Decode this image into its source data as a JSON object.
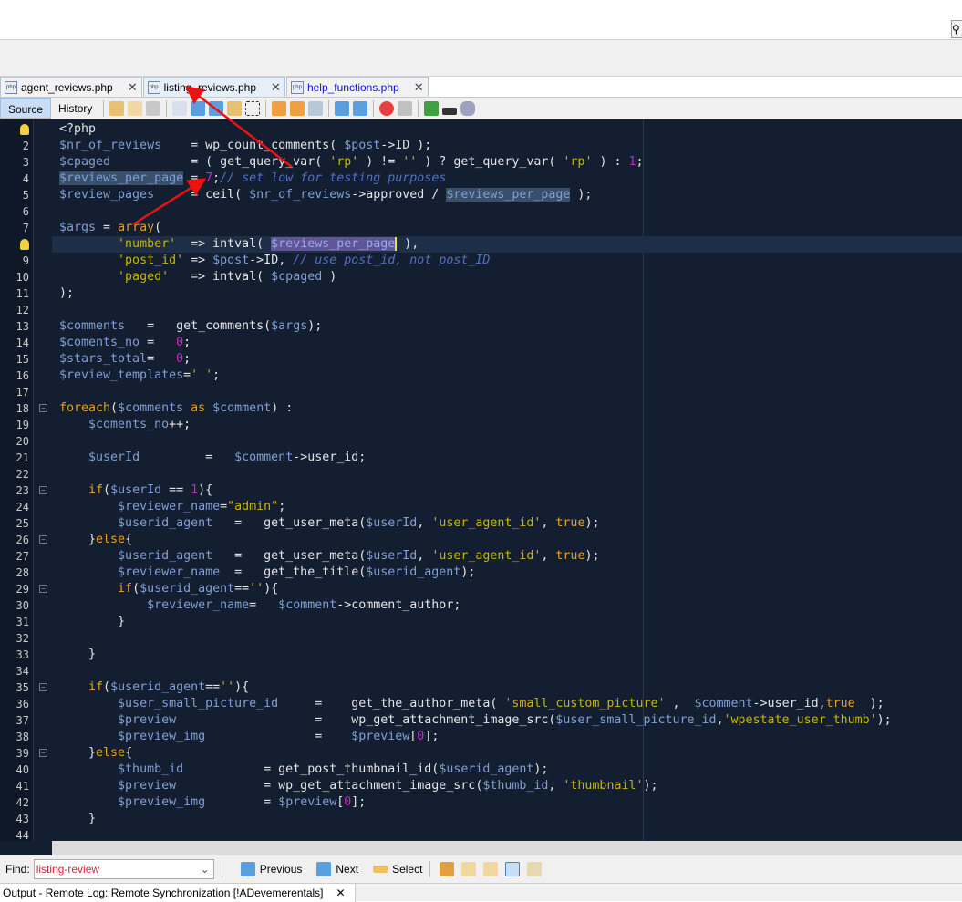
{
  "tabs": [
    {
      "label": "agent_reviews.php"
    },
    {
      "label": "listing_reviews.php",
      "active": true
    },
    {
      "label": "help_functions.php"
    }
  ],
  "toolbar": {
    "source": "Source",
    "history": "History"
  },
  "editor": {
    "lines": [
      [
        [
          "p",
          "<?php"
        ]
      ],
      [
        [
          "v",
          "$nr_of_reviews"
        ],
        [
          "p",
          "    = wp_count_comments( "
        ],
        [
          "v",
          "$post"
        ],
        [
          "p",
          "->ID );"
        ]
      ],
      [
        [
          "v",
          "$cpaged"
        ],
        [
          "p",
          "           = ( get_query_var( "
        ],
        [
          "s",
          "'rp'"
        ],
        [
          "p",
          " ) != "
        ],
        [
          "s",
          "''"
        ],
        [
          "p",
          " ) ? get_query_var( "
        ],
        [
          "s",
          "'rp'"
        ],
        [
          "p",
          " ) : "
        ],
        [
          "n",
          "1"
        ],
        [
          "p",
          ";"
        ]
      ],
      [
        [
          "h",
          "$reviews_per_page"
        ],
        [
          "p",
          " = "
        ],
        [
          "n",
          "7"
        ],
        [
          "p",
          ";"
        ],
        [
          "c",
          "// set low for testing purposes"
        ]
      ],
      [
        [
          "v",
          "$review_pages"
        ],
        [
          "p",
          "     = ceil( "
        ],
        [
          "v",
          "$nr_of_reviews"
        ],
        [
          "p",
          "->approved / "
        ],
        [
          "h",
          "$reviews_per_page"
        ],
        [
          "p",
          " );"
        ]
      ],
      [],
      [
        [
          "v",
          "$args"
        ],
        [
          "p",
          " = "
        ],
        [
          "k",
          "array"
        ],
        [
          "p",
          "("
        ]
      ],
      [
        [
          "p",
          "        "
        ],
        [
          "s",
          "'number'"
        ],
        [
          "p",
          "  => intval( "
        ],
        [
          "hp",
          "$reviews_per_page"
        ],
        [
          "p",
          " ),"
        ]
      ],
      [
        [
          "p",
          "        "
        ],
        [
          "s",
          "'post_id'"
        ],
        [
          "p",
          " => "
        ],
        [
          "v",
          "$post"
        ],
        [
          "p",
          "->ID, "
        ],
        [
          "c",
          "// use post_id, not post_ID"
        ]
      ],
      [
        [
          "p",
          "        "
        ],
        [
          "s",
          "'paged'"
        ],
        [
          "p",
          "   => intval( "
        ],
        [
          "v",
          "$cpaged"
        ],
        [
          "p",
          " )"
        ]
      ],
      [
        [
          "p",
          ");"
        ]
      ],
      [],
      [
        [
          "v",
          "$comments"
        ],
        [
          "p",
          "   =   get_comments("
        ],
        [
          "v",
          "$args"
        ],
        [
          "p",
          ");"
        ]
      ],
      [
        [
          "v",
          "$coments_no"
        ],
        [
          "p",
          " =   "
        ],
        [
          "n",
          "0"
        ],
        [
          "p",
          ";"
        ]
      ],
      [
        [
          "v",
          "$stars_total"
        ],
        [
          "p",
          "=   "
        ],
        [
          "n",
          "0"
        ],
        [
          "p",
          ";"
        ]
      ],
      [
        [
          "v",
          "$review_templates"
        ],
        [
          "p",
          "="
        ],
        [
          "s",
          "' '"
        ],
        [
          "p",
          ";"
        ]
      ],
      [],
      [
        [
          "k",
          "foreach"
        ],
        [
          "p",
          "("
        ],
        [
          "v",
          "$comments"
        ],
        [
          "k",
          " as "
        ],
        [
          "v",
          "$comment"
        ],
        [
          "p",
          ") :"
        ]
      ],
      [
        [
          "p",
          "    "
        ],
        [
          "v",
          "$coments_no"
        ],
        [
          "p",
          "++;"
        ]
      ],
      [],
      [
        [
          "p",
          "    "
        ],
        [
          "v",
          "$userId"
        ],
        [
          "p",
          "         =   "
        ],
        [
          "v",
          "$comment"
        ],
        [
          "p",
          "->user_id;"
        ]
      ],
      [],
      [
        [
          "p",
          "    "
        ],
        [
          "k",
          "if"
        ],
        [
          "p",
          "("
        ],
        [
          "v",
          "$userId"
        ],
        [
          "p",
          " == "
        ],
        [
          "n",
          "1"
        ],
        [
          "p",
          "){"
        ]
      ],
      [
        [
          "p",
          "        "
        ],
        [
          "v",
          "$reviewer_name"
        ],
        [
          "p",
          "="
        ],
        [
          "s",
          "\"admin\""
        ],
        [
          "p",
          ";"
        ]
      ],
      [
        [
          "p",
          "        "
        ],
        [
          "v",
          "$userid_agent"
        ],
        [
          "p",
          "   =   get_user_meta("
        ],
        [
          "v",
          "$userId"
        ],
        [
          "p",
          ", "
        ],
        [
          "s",
          "'user_agent_id'"
        ],
        [
          "p",
          ", "
        ],
        [
          "k",
          "true"
        ],
        [
          "p",
          ");"
        ]
      ],
      [
        [
          "p",
          "    }"
        ],
        [
          "k",
          "else"
        ],
        [
          "p",
          "{"
        ]
      ],
      [
        [
          "p",
          "        "
        ],
        [
          "v",
          "$userid_agent"
        ],
        [
          "p",
          "   =   get_user_meta("
        ],
        [
          "v",
          "$userId"
        ],
        [
          "p",
          ", "
        ],
        [
          "s",
          "'user_agent_id'"
        ],
        [
          "p",
          ", "
        ],
        [
          "k",
          "true"
        ],
        [
          "p",
          ");"
        ]
      ],
      [
        [
          "p",
          "        "
        ],
        [
          "v",
          "$reviewer_name"
        ],
        [
          "p",
          "  =   get_the_title("
        ],
        [
          "v",
          "$userid_agent"
        ],
        [
          "p",
          ");"
        ]
      ],
      [
        [
          "p",
          "        "
        ],
        [
          "k",
          "if"
        ],
        [
          "p",
          "("
        ],
        [
          "v",
          "$userid_agent"
        ],
        [
          "p",
          "=="
        ],
        [
          "s",
          "''"
        ],
        [
          "p",
          "){"
        ]
      ],
      [
        [
          "p",
          "            "
        ],
        [
          "v",
          "$reviewer_name"
        ],
        [
          "p",
          "=   "
        ],
        [
          "v",
          "$comment"
        ],
        [
          "p",
          "->comment_author;"
        ]
      ],
      [
        [
          "p",
          "        }"
        ]
      ],
      [],
      [
        [
          "p",
          "    }"
        ]
      ],
      [],
      [
        [
          "p",
          "    "
        ],
        [
          "k",
          "if"
        ],
        [
          "p",
          "("
        ],
        [
          "v",
          "$userid_agent"
        ],
        [
          "p",
          "=="
        ],
        [
          "s",
          "''"
        ],
        [
          "p",
          "){"
        ]
      ],
      [
        [
          "p",
          "        "
        ],
        [
          "v",
          "$user_small_picture_id"
        ],
        [
          "p",
          "     =    get_the_author_meta( "
        ],
        [
          "s",
          "'small_custom_picture'"
        ],
        [
          "p",
          " ,  "
        ],
        [
          "v",
          "$comment"
        ],
        [
          "p",
          "->user_id,"
        ],
        [
          "k",
          "true"
        ],
        [
          "p",
          "  );"
        ]
      ],
      [
        [
          "p",
          "        "
        ],
        [
          "v",
          "$preview"
        ],
        [
          "p",
          "                   =    wp_get_attachment_image_src("
        ],
        [
          "v",
          "$user_small_picture_id"
        ],
        [
          "p",
          ","
        ],
        [
          "s",
          "'wpestate_user_thumb'"
        ],
        [
          "p",
          ");"
        ]
      ],
      [
        [
          "p",
          "        "
        ],
        [
          "v",
          "$preview_img"
        ],
        [
          "p",
          "               =    "
        ],
        [
          "v",
          "$preview"
        ],
        [
          "p",
          "["
        ],
        [
          "n",
          "0"
        ],
        [
          "p",
          "];"
        ]
      ],
      [
        [
          "p",
          "    }"
        ],
        [
          "k",
          "else"
        ],
        [
          "p",
          "{"
        ]
      ],
      [
        [
          "p",
          "        "
        ],
        [
          "v",
          "$thumb_id"
        ],
        [
          "p",
          "           = get_post_thumbnail_id("
        ],
        [
          "v",
          "$userid_agent"
        ],
        [
          "p",
          ");"
        ]
      ],
      [
        [
          "p",
          "        "
        ],
        [
          "v",
          "$preview"
        ],
        [
          "p",
          "            = wp_get_attachment_image_src("
        ],
        [
          "v",
          "$thumb_id"
        ],
        [
          "p",
          ", "
        ],
        [
          "s",
          "'thumbnail'"
        ],
        [
          "p",
          ");"
        ]
      ],
      [
        [
          "p",
          "        "
        ],
        [
          "v",
          "$preview_img"
        ],
        [
          "p",
          "        = "
        ],
        [
          "v",
          "$preview"
        ],
        [
          "p",
          "["
        ],
        [
          "n",
          "0"
        ],
        [
          "p",
          "];"
        ]
      ],
      [
        [
          "p",
          "    }"
        ]
      ],
      []
    ],
    "current_line": 8,
    "bulb_lines": [
      1,
      8
    ],
    "fold_lines": [
      18,
      23,
      26,
      29,
      35,
      39
    ]
  },
  "find": {
    "label": "Find:",
    "value": "listing-review",
    "previous": "Previous",
    "next": "Next",
    "select": "Select"
  },
  "output": {
    "title": "Output - Remote Log: Remote Synchronization [!ADevemerentals]"
  },
  "colors": {
    "editor_bg": "#131e30",
    "variable": "#7f9fd6",
    "keyword": "#e8a020",
    "string": "#c8b400",
    "number": "#d020d0",
    "comment": "#4f70c8",
    "annotation_arrow": "#ee1111"
  }
}
